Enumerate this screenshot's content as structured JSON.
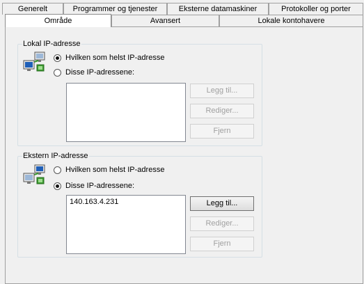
{
  "tabs_row1": [
    "Generelt",
    "Programmer og tjenester",
    "Eksterne datamaskiner",
    "Protokoller og porter"
  ],
  "tabs_row2": [
    "Område",
    "Avansert",
    "Lokale kontohavere"
  ],
  "local": {
    "title": "Lokal IP-adresse",
    "radio_any": "Hvilken som helst IP-adresse",
    "radio_these": "Disse IP-adressene:",
    "selected": "any",
    "list": [],
    "buttons": {
      "add": "Legg til...",
      "edit": "Rediger...",
      "remove": "Fjern"
    }
  },
  "remote": {
    "title": "Ekstern IP-adresse",
    "radio_any": "Hvilken som helst IP-adresse",
    "radio_these": "Disse IP-adressene:",
    "selected": "these",
    "list": [
      "140.163.4.231"
    ],
    "buttons": {
      "add": "Legg til...",
      "edit": "Rediger...",
      "remove": "Fjern"
    }
  },
  "icons": {
    "local": "local-computer-network-icon",
    "remote": "remote-computers-network-icon"
  },
  "colors": {
    "accent_green": "#3a9a2e",
    "monitor_blue": "#1f5fb8"
  }
}
